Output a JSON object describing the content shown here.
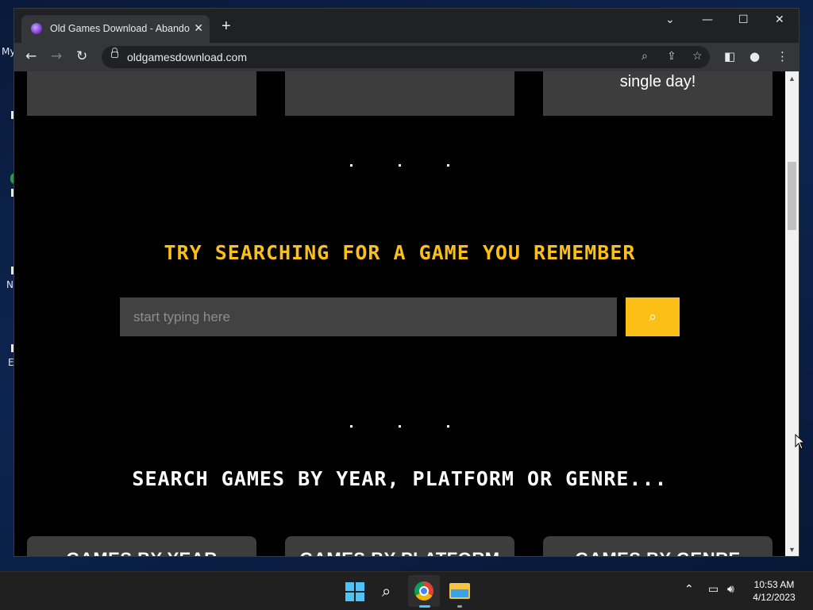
{
  "browser": {
    "tab_title": "Old Games Download - Abandonware",
    "new_tab_icon": "+",
    "close_tab_icon": "✕",
    "url": "oldgamesdownload.com",
    "window_controls": {
      "minimize": "—",
      "maximize": "☐",
      "close": "✕",
      "tab_search": "⌄"
    }
  },
  "page": {
    "top_cards": [
      {
        "text": ""
      },
      {
        "text": ""
      },
      {
        "text": "single day!"
      }
    ],
    "search_heading": "TRY SEARCHING FOR A GAME YOU REMEMBER",
    "search_placeholder": "start typing here",
    "search_button_icon": "⌕",
    "browse_heading": "SEARCH GAMES BY YEAR, PLATFORM OR GENRE...",
    "browse_cards": [
      {
        "label": "GAMES BY YEAR"
      },
      {
        "label": "GAMES BY PLATFORM"
      },
      {
        "label": "GAMES BY GENRE"
      }
    ],
    "accent_color": "#fbbf17"
  },
  "desktop": {
    "icon_labels": [
      "My",
      "N",
      "E"
    ]
  },
  "taskbar": {
    "time": "10:53 AM",
    "date": "4/12/2023"
  }
}
